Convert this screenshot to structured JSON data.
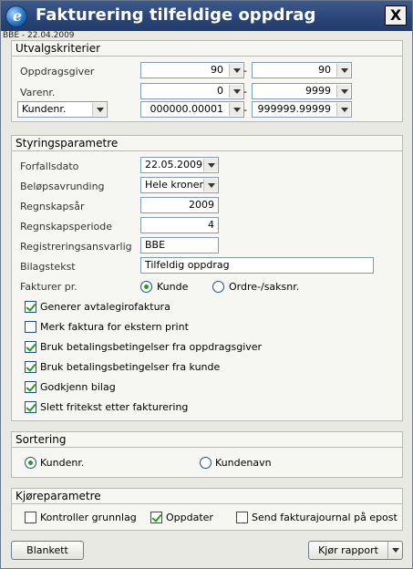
{
  "window": {
    "title": "Fakturering tilfeldige oppdrag",
    "subtitle": "BBE - 22.04.2009",
    "close_label": "X"
  },
  "utvalg": {
    "heading": "Utvalgskriterier",
    "oppdragsgiver": {
      "label": "Oppdragsgiver",
      "from": "90",
      "to": "90"
    },
    "varenr": {
      "label": "Varenr.",
      "from": "0",
      "to": "9999"
    },
    "kundenr": {
      "selector": "Kundenr.",
      "from": "000000.00001",
      "to": "999999.99999"
    },
    "separator": "-"
  },
  "styring": {
    "heading": "Styringsparametre",
    "forfallsdato": {
      "label": "Forfallsdato",
      "value": "22.05.2009"
    },
    "belopsavrunding": {
      "label": "Beløpsavrunding",
      "value": "Hele kroner"
    },
    "regnskapsar": {
      "label": "Regnskapsår",
      "value": "2009"
    },
    "regnskapsperiode": {
      "label": "Regnskapsperiode",
      "value": "4"
    },
    "registreringsansvarlig": {
      "label": "Registreringsansvarlig",
      "value": "BBE"
    },
    "bilagstekst": {
      "label": "Bilagstekst",
      "value": "Tilfeldig oppdrag"
    },
    "fakturer_pr": {
      "label": "Fakturer pr.",
      "option1": "Kunde",
      "option2": "Ordre-/saksnr.",
      "selected": "Kunde"
    },
    "checks": [
      {
        "label": "Generer avtalegirofaktura",
        "checked": true
      },
      {
        "label": "Merk faktura for ekstern print",
        "checked": false
      },
      {
        "label": "Bruk betalingsbetingelser fra oppdragsgiver",
        "checked": true
      },
      {
        "label": "Bruk betalingsbetingelser fra kunde",
        "checked": true
      },
      {
        "label": "Godkjenn bilag",
        "checked": true
      },
      {
        "label": "Slett fritekst etter fakturering",
        "checked": true
      }
    ]
  },
  "sortering": {
    "heading": "Sortering",
    "option1": "Kundenr.",
    "option2": "Kundenavn",
    "selected": "Kundenr."
  },
  "kjore": {
    "heading": "Kjøreparametre",
    "checks": [
      {
        "label": "Kontroller grunnlag",
        "checked": false
      },
      {
        "label": "Oppdater",
        "checked": true
      },
      {
        "label": "Send fakturajournal på epost",
        "checked": false
      }
    ]
  },
  "footer": {
    "blankett": "Blankett",
    "kjor_rapport": "Kjør rapport"
  }
}
